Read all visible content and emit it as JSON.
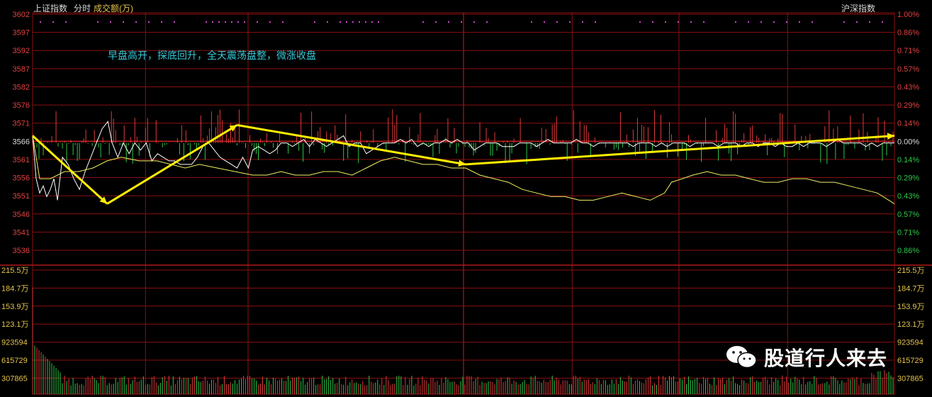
{
  "header": {
    "left_title": "上证指数",
    "mode": "分时",
    "volume_label": "成交额(万)",
    "right_title": "沪深指数"
  },
  "annotation": "早盘高开，探底回升，全天震荡盘整，微涨收盘",
  "watermark": "股道行人来去",
  "colors": {
    "background": "#000000",
    "grid": "#8a1010",
    "price_line": "#ffffff",
    "avg_line": "#f0f060",
    "up_bar": "#e23a3a",
    "down_bar": "#2ec84a",
    "tick_label": "#e04040",
    "volume_label": "#e3c34a",
    "arrow": "#ffee00",
    "annotation": "#35c6d6",
    "flag_dots": "#d040d0"
  },
  "chart_data": {
    "type": "line",
    "title": "上证指数 分时",
    "y_ticks": [
      3602,
      3597,
      3592,
      3587,
      3582,
      3576,
      3571,
      3566,
      3561,
      3556,
      3551,
      3546,
      3541,
      3536
    ],
    "pct_ticks": [
      "1.00%",
      "0.86%",
      "0.71%",
      "0.57%",
      "0.43%",
      "0.29%",
      "0.14%",
      "0.00%",
      "0.14%",
      "0.29%",
      "0.43%",
      "0.57%",
      "0.71%",
      "0.86%"
    ],
    "ylim": [
      3536,
      3602
    ],
    "baseline": 3566,
    "volume_ticks": [
      "215.5万",
      "184.7万",
      "153.9万",
      "123.1万",
      "923594",
      "615729",
      "307865"
    ],
    "volume_ylim": [
      0,
      2155000
    ],
    "series": [
      {
        "name": "price",
        "points": [
          [
            0,
            3568
          ],
          [
            5,
            3556
          ],
          [
            10,
            3552
          ],
          [
            15,
            3554
          ],
          [
            20,
            3551
          ],
          [
            25,
            3553
          ],
          [
            30,
            3556
          ],
          [
            35,
            3550
          ],
          [
            42,
            3562
          ],
          [
            50,
            3560
          ],
          [
            58,
            3556
          ],
          [
            66,
            3553
          ],
          [
            74,
            3558
          ],
          [
            82,
            3562
          ],
          [
            90,
            3566
          ],
          [
            98,
            3570
          ],
          [
            106,
            3572
          ],
          [
            112,
            3566
          ],
          [
            120,
            3562
          ],
          [
            128,
            3566
          ],
          [
            136,
            3563
          ],
          [
            144,
            3566
          ],
          [
            152,
            3564
          ],
          [
            160,
            3566
          ],
          [
            168,
            3561
          ],
          [
            176,
            3563
          ],
          [
            184,
            3562
          ],
          [
            192,
            3561
          ],
          [
            200,
            3561
          ],
          [
            208,
            3560
          ],
          [
            216,
            3560
          ],
          [
            224,
            3560
          ],
          [
            232,
            3562
          ],
          [
            240,
            3565
          ],
          [
            248,
            3566
          ],
          [
            256,
            3564
          ],
          [
            264,
            3562
          ],
          [
            272,
            3561
          ],
          [
            280,
            3560
          ],
          [
            288,
            3559
          ],
          [
            296,
            3562
          ],
          [
            304,
            3559
          ],
          [
            310,
            3564
          ],
          [
            318,
            3565
          ],
          [
            326,
            3564
          ],
          [
            334,
            3563
          ],
          [
            342,
            3564
          ],
          [
            350,
            3566
          ],
          [
            358,
            3566
          ],
          [
            366,
            3565
          ],
          [
            374,
            3566
          ],
          [
            382,
            3567
          ],
          [
            390,
            3565
          ],
          [
            398,
            3567
          ],
          [
            406,
            3566
          ],
          [
            414,
            3565
          ],
          [
            422,
            3566
          ],
          [
            430,
            3567
          ],
          [
            438,
            3568
          ],
          [
            446,
            3565
          ],
          [
            454,
            3566
          ],
          [
            462,
            3566
          ],
          [
            470,
            3563
          ],
          [
            478,
            3564
          ],
          [
            486,
            3565
          ],
          [
            494,
            3566
          ],
          [
            502,
            3566
          ],
          [
            510,
            3566
          ],
          [
            518,
            3567
          ],
          [
            526,
            3566
          ],
          [
            534,
            3567
          ],
          [
            542,
            3565
          ],
          [
            550,
            3566
          ],
          [
            558,
            3565
          ],
          [
            566,
            3566
          ],
          [
            574,
            3566
          ],
          [
            582,
            3567
          ],
          [
            590,
            3566
          ],
          [
            598,
            3567
          ],
          [
            606,
            3566
          ],
          [
            614,
            3566
          ],
          [
            622,
            3564
          ],
          [
            630,
            3565
          ],
          [
            638,
            3566
          ],
          [
            646,
            3566
          ],
          [
            654,
            3566
          ],
          [
            662,
            3565
          ],
          [
            670,
            3565
          ],
          [
            678,
            3565
          ],
          [
            686,
            3566
          ],
          [
            694,
            3566
          ],
          [
            702,
            3566
          ],
          [
            710,
            3565
          ],
          [
            718,
            3566
          ],
          [
            726,
            3567
          ],
          [
            734,
            3566
          ],
          [
            742,
            3566
          ],
          [
            750,
            3566
          ],
          [
            758,
            3566
          ],
          [
            766,
            3567
          ],
          [
            774,
            3566
          ],
          [
            782,
            3566
          ],
          [
            790,
            3565
          ],
          [
            798,
            3566
          ],
          [
            806,
            3566
          ],
          [
            814,
            3566
          ],
          [
            822,
            3566
          ],
          [
            830,
            3566
          ],
          [
            838,
            3566
          ],
          [
            846,
            3565
          ],
          [
            854,
            3566
          ],
          [
            862,
            3566
          ],
          [
            870,
            3566
          ],
          [
            878,
            3565
          ],
          [
            886,
            3566
          ],
          [
            894,
            3565
          ],
          [
            902,
            3566
          ],
          [
            910,
            3566
          ],
          [
            918,
            3566
          ],
          [
            926,
            3565
          ],
          [
            934,
            3566
          ],
          [
            942,
            3566
          ],
          [
            950,
            3566
          ],
          [
            958,
            3566
          ],
          [
            966,
            3565
          ],
          [
            974,
            3566
          ],
          [
            982,
            3566
          ],
          [
            990,
            3566
          ],
          [
            998,
            3565
          ],
          [
            1006,
            3566
          ],
          [
            1014,
            3566
          ],
          [
            1022,
            3565
          ],
          [
            1030,
            3566
          ],
          [
            1038,
            3566
          ],
          [
            1046,
            3565
          ],
          [
            1054,
            3566
          ],
          [
            1062,
            3565
          ],
          [
            1070,
            3565
          ],
          [
            1078,
            3566
          ],
          [
            1086,
            3565
          ],
          [
            1094,
            3566
          ],
          [
            1102,
            3566
          ],
          [
            1110,
            3566
          ],
          [
            1118,
            3565
          ],
          [
            1126,
            3566
          ],
          [
            1134,
            3567
          ],
          [
            1142,
            3566
          ],
          [
            1150,
            3566
          ],
          [
            1158,
            3566
          ],
          [
            1166,
            3566
          ],
          [
            1174,
            3565
          ],
          [
            1182,
            3566
          ],
          [
            1190,
            3565
          ],
          [
            1198,
            3566
          ],
          [
            1206,
            3566
          ],
          [
            1214,
            3566
          ]
        ]
      },
      {
        "name": "average",
        "points": [
          [
            0,
            3568
          ],
          [
            10,
            3556
          ],
          [
            25,
            3556
          ],
          [
            45,
            3558
          ],
          [
            65,
            3558
          ],
          [
            85,
            3559
          ],
          [
            105,
            3561
          ],
          [
            125,
            3562
          ],
          [
            150,
            3561
          ],
          [
            175,
            3561
          ],
          [
            195,
            3560
          ],
          [
            215,
            3559
          ],
          [
            235,
            3560
          ],
          [
            260,
            3559
          ],
          [
            285,
            3558
          ],
          [
            310,
            3557
          ],
          [
            330,
            3557
          ],
          [
            350,
            3558
          ],
          [
            370,
            3557
          ],
          [
            390,
            3557
          ],
          [
            410,
            3558
          ],
          [
            430,
            3558
          ],
          [
            450,
            3557
          ],
          [
            470,
            3559
          ],
          [
            490,
            3561
          ],
          [
            510,
            3562
          ],
          [
            530,
            3561
          ],
          [
            550,
            3560
          ],
          [
            570,
            3560
          ],
          [
            590,
            3559
          ],
          [
            610,
            3559
          ],
          [
            630,
            3557
          ],
          [
            650,
            3556
          ],
          [
            670,
            3555
          ],
          [
            690,
            3553
          ],
          [
            710,
            3552
          ],
          [
            730,
            3551
          ],
          [
            750,
            3551
          ],
          [
            770,
            3550
          ],
          [
            790,
            3550
          ],
          [
            810,
            3551
          ],
          [
            830,
            3552
          ],
          [
            850,
            3551
          ],
          [
            870,
            3550
          ],
          [
            890,
            3552
          ],
          [
            900,
            3555
          ],
          [
            915,
            3556
          ],
          [
            930,
            3557
          ],
          [
            950,
            3558
          ],
          [
            970,
            3557
          ],
          [
            990,
            3557
          ],
          [
            1010,
            3556
          ],
          [
            1030,
            3555
          ],
          [
            1050,
            3555
          ],
          [
            1070,
            3556
          ],
          [
            1090,
            3556
          ],
          [
            1110,
            3555
          ],
          [
            1130,
            3555
          ],
          [
            1150,
            3554
          ],
          [
            1170,
            3553
          ],
          [
            1190,
            3552
          ],
          [
            1214,
            3549
          ]
        ]
      }
    ],
    "trend_arrows": [
      {
        "from": [
          0,
          3568
        ],
        "to": [
          105,
          3549
        ]
      },
      {
        "from": [
          105,
          3549
        ],
        "to": [
          288,
          3571
        ]
      },
      {
        "from": [
          288,
          3571
        ],
        "to": [
          610,
          3560
        ]
      },
      {
        "from": [
          610,
          3560
        ],
        "to": [
          1214,
          3568
        ]
      }
    ]
  }
}
